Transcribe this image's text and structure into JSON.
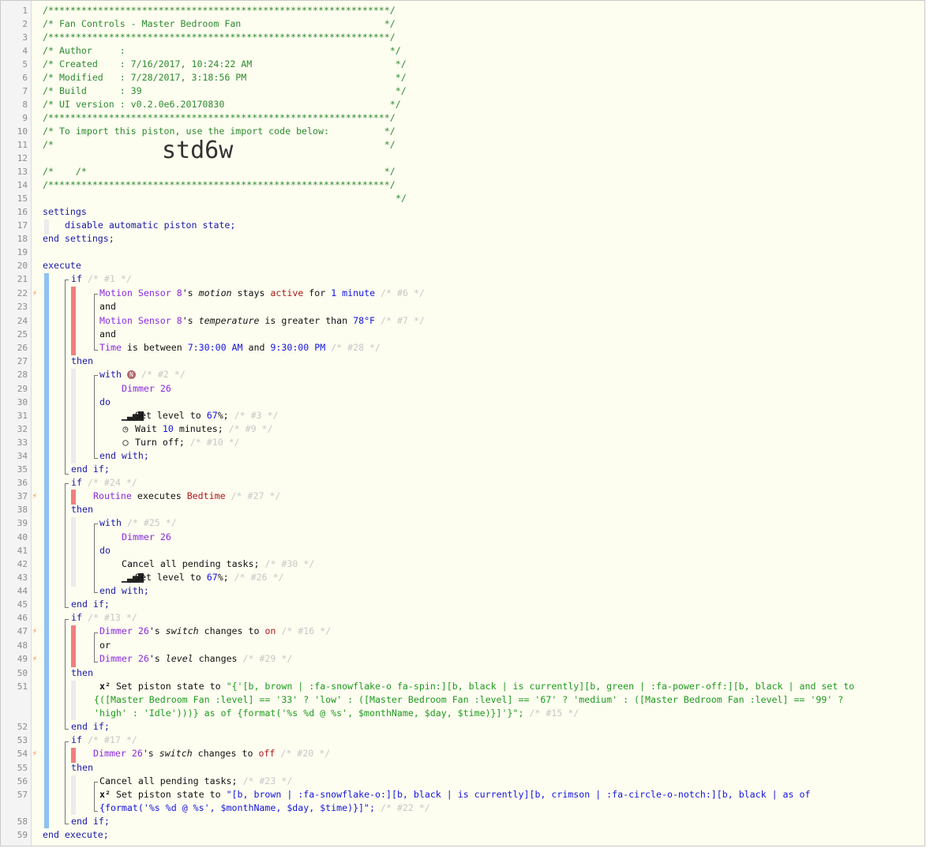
{
  "header": {
    "title": "/* Fan Controls - Master Bedroom Fan                          */",
    "stars": "/**************************************************************/",
    "author_label": "/* Author     : ",
    "author_value": "        ",
    "author_end": "                                       */",
    "created": "/* Created    : 7/16/2017, 10:24:22 AM                          */",
    "modified": "/* Modified   : 7/28/2017, 3:18:56 PM                           */",
    "build": "/* Build      : 39                                              */",
    "ui_version": "/* UI version : v0.2.0e6.20170830                              */",
    "import_note": "/* To import this piston, use the import code below:          */",
    "blank": "/*                                                            */",
    "code_prefix": "/*",
    "code_suffix": "*/",
    "import_code": "std6w"
  },
  "lines": {
    "settings": "settings",
    "disable": "disable automatic piston state;",
    "end_settings": "end settings;",
    "execute": "execute",
    "end_execute": "end execute;",
    "if": "if",
    "then": "then",
    "and": "and",
    "or": "or",
    "with": "with",
    "do": "do",
    "end_with": "end with;",
    "end_if": "end if;"
  },
  "block1": {
    "if_id": "/* #1 */",
    "c1_device": "Motion Sensor 8",
    "c1_s": "'s ",
    "c1_attr": "motion",
    "c1_op": " stays ",
    "c1_val": "active",
    "c1_for": " for ",
    "c1_dur": "1 minute",
    "c1_id": " /* #6 */",
    "c2_device": "Motion Sensor 8",
    "c2_s": "'s ",
    "c2_attr": "temperature",
    "c2_op": " is greater than ",
    "c2_val": "78°F",
    "c2_id": " /* #7 */",
    "c3_device": "Time",
    "c3_op": " is between ",
    "c3_v1": "7:30:00 AM",
    "c3_and": " and ",
    "c3_v2": "9:30:00 PM",
    "c3_id": " /* #28 */",
    "with_id": "/* #2 */",
    "device": "Dimmer 26",
    "a1": "Set level to ",
    "a1_val": "67",
    "a1_end": "%;",
    "a1_id": " /* #3 */",
    "a2": "Wait ",
    "a2_val": "10",
    "a2_end": " minutes;",
    "a2_id": " /* #9 */",
    "a3": "Turn off;",
    "a3_id": " /* #10 */"
  },
  "block2": {
    "if_id": "/* #24 */",
    "c1_device": "Routine",
    "c1_op": " executes ",
    "c1_val": "Bedtime",
    "c1_id": " /* #27 */",
    "with_id": "/* #25 */",
    "device": "Dimmer 26",
    "a1": "Cancel all pending tasks;",
    "a1_id": " /* #30 */",
    "a2": "Set level to ",
    "a2_val": "67",
    "a2_end": "%;",
    "a2_id": " /* #26 */"
  },
  "block3": {
    "if_id": "/* #13 */",
    "c1_device": "Dimmer 26",
    "c1_s": "'s ",
    "c1_attr": "switch",
    "c1_op": " changes to ",
    "c1_val": "on",
    "c1_id": " /* #16 */",
    "c2_device": "Dimmer 26",
    "c2_s": "'s ",
    "c2_attr": "level",
    "c2_op": " changes",
    "c2_id": " /* #29 */",
    "a1": "Set piston state to ",
    "a1_val": "\"{'[b, brown | :fa-snowflake-o fa-spin:][b, black | is currently][b, green | :fa-power-off:][b, black | and set to {([Master Bedroom Fan :level] == '33' ? 'low' : ([Master Bedroom Fan :level] == '67' ? 'medium' : ([Master Bedroom Fan :level] == '99' ? 'high' : 'Idle')))} as of {format('%s %d @ %s', $monthName, $day, $time)}]'}\";",
    "a1_id": " /* #15 */"
  },
  "block4": {
    "if_id": "/* #17 */",
    "c1_device": "Dimmer 26",
    "c1_s": "'s ",
    "c1_attr": "switch",
    "c1_op": " changes to ",
    "c1_val": "off",
    "c1_id": " /* #20 */",
    "a1": "Cancel all pending tasks;",
    "a1_id": " /* #23 */",
    "a2": "Set piston state to ",
    "a2_val": "\"[b, brown | :fa-snowflake-o:][b, black | is currently][b, crimson | :fa-circle-o-notch:][b, black | as of {format('%s %d @ %s', $monthName, $day, $time)}]\";",
    "a2_id": " /* #22 */"
  },
  "icons": {
    "level": "signal-bars-icon",
    "wait": "clock-icon",
    "off": "power-circle-icon",
    "expression": "superscript-x-icon",
    "trigger": "lightning-bolt-icon",
    "wizard": "wizard-icon"
  },
  "colors": {
    "keyword": "#1a1aaa",
    "device": "#8a2be2",
    "value": "#b01818",
    "comment": "#2e8b2e",
    "id_comment": "#c8c8c8",
    "trigger": "#f2832a",
    "bar_blue": "#8fc1f2",
    "bar_red": "#ef7f7f"
  }
}
